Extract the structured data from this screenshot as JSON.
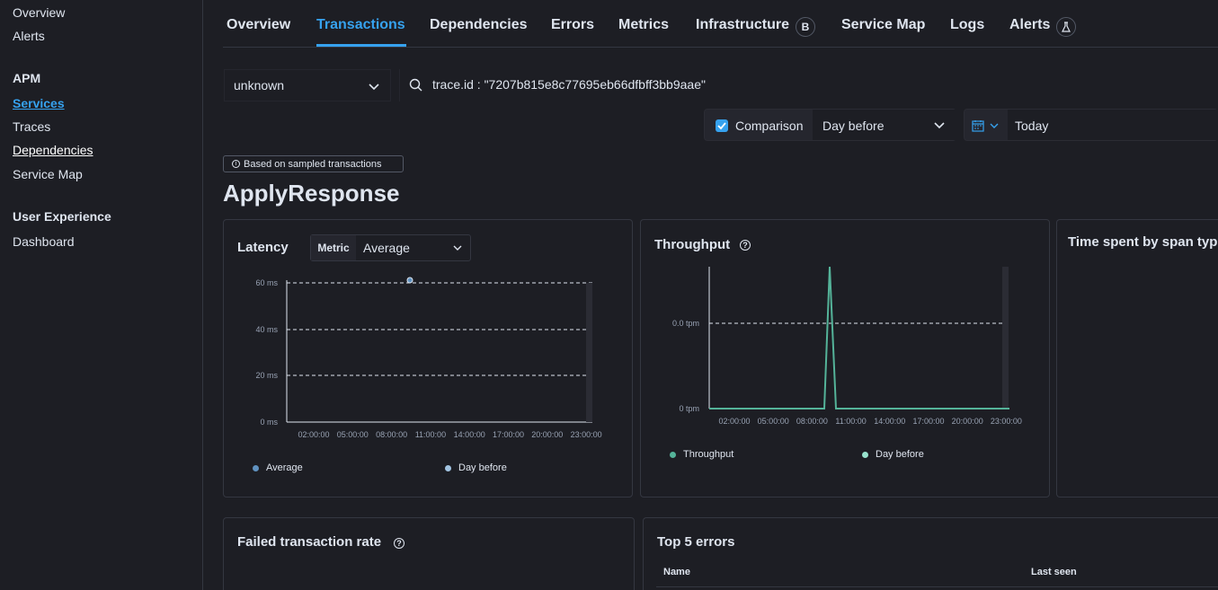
{
  "sidebar": {
    "overview": "Overview",
    "alerts": "Alerts",
    "apm_heading": "APM",
    "services": "Services",
    "traces": "Traces",
    "dependencies": "Dependencies",
    "service_map": "Service Map",
    "ux_heading": "User Experience",
    "dashboard": "Dashboard"
  },
  "tabs": {
    "overview": "Overview",
    "transactions": "Transactions",
    "dependencies": "Dependencies",
    "errors": "Errors",
    "metrics": "Metrics",
    "infrastructure": "Infrastructure",
    "infrastructure_badge": "B",
    "service_map": "Service Map",
    "logs": "Logs",
    "alerts": "Alerts"
  },
  "filters": {
    "environment": "unknown",
    "query": "trace.id : \"7207b815e8c77695eb66dfbff3bb9aae\"",
    "comparison_label": "Comparison",
    "comparison_checked": true,
    "comparison_value": "Day before",
    "date_value": "Today"
  },
  "sampled_badge": "Based on sampled transactions",
  "page_title": "ApplyResponse",
  "latency": {
    "title": "Latency",
    "metric_prefix": "Metric",
    "metric_value": "Average",
    "legend_primary": "Average",
    "legend_compare": "Day before"
  },
  "throughput": {
    "title": "Throughput",
    "legend_primary": "Throughput",
    "legend_compare": "Day before"
  },
  "time_spent_title": "Time spent by span typ",
  "failed_rate_title": "Failed transaction rate",
  "top_errors": {
    "title": "Top 5 errors",
    "col_name": "Name",
    "col_last_seen": "Last seen"
  },
  "colors": {
    "accent": "#36a2ef",
    "latency_series": "#6092c0",
    "latency_compare": "#a2c4e2",
    "throughput_series": "#54b399",
    "throughput_compare": "#98e2cd"
  },
  "chart_data": [
    {
      "type": "line",
      "name": "latency",
      "title": "",
      "x": [
        "02:00:00",
        "05:00:00",
        "08:00:00",
        "11:00:00",
        "14:00:00",
        "17:00:00",
        "20:00:00",
        "23:00:00"
      ],
      "ytick_labels": [
        "0 ms",
        "20 ms",
        "40 ms",
        "60 ms"
      ],
      "ylim": [
        0,
        60
      ],
      "grid": true,
      "legend": "bottom",
      "series": [
        {
          "name": "Average",
          "points": [
            {
              "x": "09:50:00",
              "y": 61
            }
          ]
        },
        {
          "name": "Day before",
          "points": []
        }
      ]
    },
    {
      "type": "line",
      "name": "throughput",
      "title": "",
      "x": [
        "02:00:00",
        "05:00:00",
        "08:00:00",
        "11:00:00",
        "14:00:00",
        "17:00:00",
        "20:00:00",
        "23:00:00"
      ],
      "ytick_labels": [
        "0 tpm",
        "0.0 tpm"
      ],
      "grid": true,
      "legend": "bottom",
      "series": [
        {
          "name": "Throughput",
          "shape": "single spike at ~09:30:00 above 0.0 tpm, otherwise 0 tpm"
        },
        {
          "name": "Day before",
          "shape": "not drawn"
        }
      ]
    }
  ]
}
